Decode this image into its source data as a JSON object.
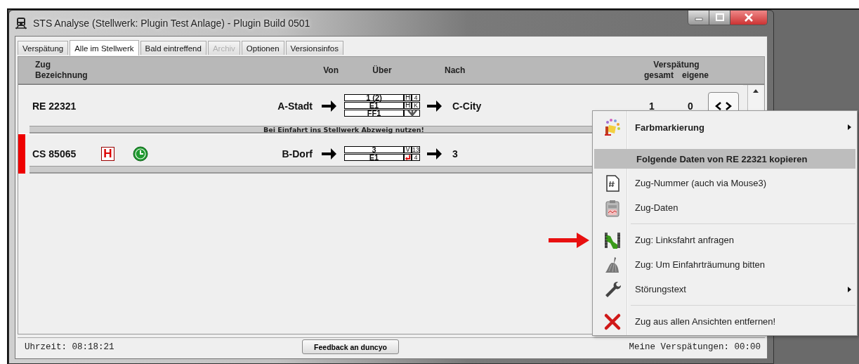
{
  "window": {
    "title": "STS Analyse (Stellwerk: Plugin Test Anlage) - Plugin Build 0501"
  },
  "tabs": [
    {
      "label": "Verspätung",
      "selected": false,
      "disabled": false
    },
    {
      "label": "Alle im Stellwerk",
      "selected": true,
      "disabled": false
    },
    {
      "label": "Bald eintreffend",
      "selected": false,
      "disabled": false
    },
    {
      "label": "Archiv",
      "selected": false,
      "disabled": true
    },
    {
      "label": "Optionen",
      "selected": false,
      "disabled": false
    },
    {
      "label": "Versionsinfos",
      "selected": false,
      "disabled": false
    }
  ],
  "header": {
    "train": [
      "Zug",
      "Bezeichnung"
    ],
    "from": "Von",
    "via": "Über",
    "to": "Nach",
    "delay": "Verspätung",
    "total": "gesamt",
    "own": "eigene"
  },
  "trains": [
    {
      "name": "RE 22321",
      "from": "A-Stadt",
      "via": [
        {
          "track": "1 (2)",
          "mark": {
            "kind": "letter",
            "text": "H"
          },
          "value": "4"
        },
        {
          "track": "E1",
          "mark": {
            "kind": "letter",
            "text": "H"
          },
          "value": "K"
        },
        {
          "track": "FF1",
          "mark": {
            "kind": "down-arrow"
          }
        }
      ],
      "to": "C-City",
      "delay_total": "1",
      "delay_own": "0",
      "note": "Bei Einfahrt ins Stellwerk Abzweig nutzen!"
    },
    {
      "name": "CS 85065",
      "color": "#ee0000",
      "signs": [
        {
          "kind": "letter",
          "text": "H"
        },
        {
          "kind": "clock"
        }
      ],
      "from": "B-Dorf",
      "via": [
        {
          "track": "3",
          "mark": {
            "kind": "letter",
            "text": "V"
          },
          "value": "13"
        },
        {
          "track": "E1",
          "mark": {
            "kind": "reverse"
          },
          "value": "4"
        }
      ],
      "to": "3"
    }
  ],
  "context_menu": {
    "items": [
      {
        "kind": "heading-item",
        "label": "Farbmarkierung",
        "submenu": true
      },
      {
        "kind": "header",
        "label": "Folgende Daten von RE 22321 kopieren"
      },
      {
        "kind": "item",
        "label": "Zug-Nummer (auch via Mouse3)",
        "submenu": false
      },
      {
        "kind": "item",
        "label": "Zug-Daten",
        "submenu": false
      },
      {
        "kind": "separator"
      },
      {
        "kind": "item",
        "label": "Zug: Linksfahrt anfragen",
        "submenu": false
      },
      {
        "kind": "item",
        "label": "Zug: Um Einfahrträumung bitten",
        "submenu": false
      },
      {
        "kind": "item",
        "label": "Störungstext",
        "submenu": true
      },
      {
        "kind": "separator"
      },
      {
        "kind": "item",
        "label": "Zug aus allen Ansichten entfernen!",
        "submenu": false
      }
    ]
  },
  "status_bar": {
    "time": "Uhrzeit: 08:18:21",
    "button": "Feedback an duncyo",
    "own_delay": "Meine Verspätungen: 00:00"
  }
}
